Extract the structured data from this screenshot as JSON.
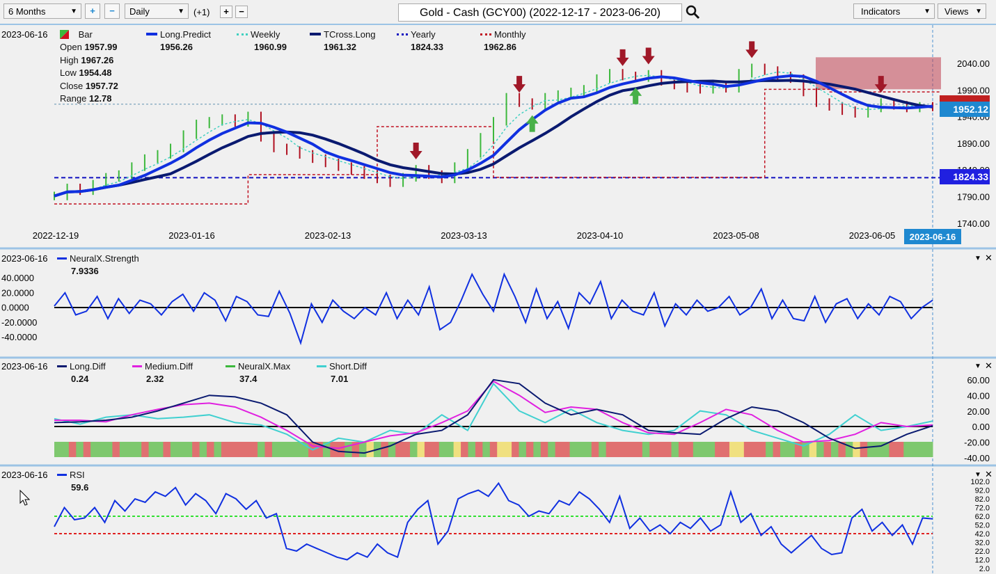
{
  "toolbar": {
    "period": "6 Months",
    "interval": "Daily",
    "offset": "(+1)",
    "title": "Gold - Cash (GCY00) (2022-12-17 - 2023-06-20)",
    "indicators": "Indicators",
    "views": "Views"
  },
  "price_panel": {
    "date": "2023-06-16",
    "bar_label": "Bar",
    "ohlc": [
      {
        "k": "Open",
        "v": "1957.99"
      },
      {
        "k": "High",
        "v": "1967.26"
      },
      {
        "k": "Low",
        "v": "1954.48"
      },
      {
        "k": "Close",
        "v": "1957.72"
      },
      {
        "k": "Range",
        "v": "12.78"
      }
    ],
    "legend": [
      {
        "name": "Long.Predict",
        "value": "1956.26",
        "color": "#1030e0"
      },
      {
        "name": "Weekly",
        "value": "1960.99",
        "color": "#40d0c0"
      },
      {
        "name": "TCross.Long",
        "value": "1961.32",
        "color": "#0a1a70"
      },
      {
        "name": "Yearly",
        "value": "1824.33",
        "color": "#1010c0"
      },
      {
        "name": "Monthly",
        "value": "1962.86",
        "color": "#c01020"
      }
    ],
    "y_ticks": [
      "2040.00",
      "1990.00",
      "1940.00",
      "1890.00",
      "1840.00",
      "1790.00",
      "1740.00"
    ],
    "x_ticks": [
      "2022-12-19",
      "2023-01-16",
      "2023-02-13",
      "2023-03-13",
      "2023-04-10",
      "2023-05-08",
      "2023-06-05"
    ],
    "current_date": "2023-06-16",
    "last_price": "1952.12",
    "yearly_label": "1824.33"
  },
  "chart_data": [
    {
      "type": "bar",
      "name": "price",
      "ylim": [
        1740,
        2060
      ],
      "yearly": 1824.33,
      "close": [
        1790,
        1805,
        1800,
        1812,
        1825,
        1830,
        1845,
        1860,
        1868,
        1880,
        1905,
        1925,
        1930,
        1935,
        1928,
        1940,
        1900,
        1880,
        1875,
        1868,
        1860,
        1852,
        1845,
        1838,
        1830,
        1822,
        1815,
        1825,
        1840,
        1830,
        1822,
        1845,
        1870,
        1900,
        1930,
        1975,
        1965,
        1960,
        1975,
        1980,
        1985,
        1990,
        2010,
        2020,
        2015,
        2012,
        2018,
        2005,
        1998,
        1992,
        1990,
        1995,
        1992,
        2020,
        2030,
        2025,
        2015,
        2010,
        1985,
        1965,
        1958,
        1950,
        1945,
        1955,
        1965,
        1960,
        1955,
        1958,
        1957
      ]
    },
    {
      "type": "line",
      "name": "NeuralX.Strength",
      "value": "7.9336",
      "ylim": [
        -50,
        50
      ],
      "y_ticks": [
        "40.0000",
        "20.0000",
        "0.0000",
        "-20.0000",
        "-40.0000"
      ],
      "values": [
        2,
        20,
        -10,
        -5,
        15,
        -15,
        12,
        -8,
        10,
        5,
        -10,
        8,
        18,
        -5,
        20,
        10,
        -18,
        15,
        8,
        -10,
        -12,
        22,
        -8,
        -48,
        5,
        -20,
        10,
        -5,
        -15,
        0,
        -10,
        20,
        -15,
        10,
        -10,
        28,
        -30,
        -20,
        10,
        45,
        18,
        -5,
        45,
        15,
        -20,
        25,
        -15,
        8,
        -28,
        20,
        5,
        35,
        -15,
        10,
        -5,
        -10,
        20,
        -25,
        5,
        -10,
        10,
        -5,
        0,
        15,
        -10,
        0,
        25,
        -15,
        10,
        -15,
        -18,
        15,
        -20,
        5,
        12,
        -15,
        5,
        -10,
        15,
        8,
        -15,
        0,
        10
      ]
    },
    {
      "type": "line",
      "name": "oscillators",
      "ylim": [
        -45,
        65
      ],
      "y_ticks": [
        "60.00",
        "40.00",
        "20.00",
        "0.00",
        "-20.00",
        "-40.00"
      ],
      "series": [
        {
          "name": "Long.Diff",
          "value": "0.24",
          "color": "#0a1a70",
          "values": [
            5,
            6,
            8,
            12,
            20,
            30,
            40,
            38,
            30,
            15,
            -20,
            -32,
            -34,
            -25,
            -10,
            -5,
            15,
            60,
            55,
            30,
            15,
            22,
            15,
            -5,
            -8,
            -10,
            10,
            25,
            20,
            5,
            -15,
            -28,
            -25,
            -10,
            1
          ]
        },
        {
          "name": "Medium.Diff",
          "value": "2.32",
          "color": "#e020e0",
          "values": [
            8,
            8,
            6,
            15,
            22,
            28,
            30,
            25,
            12,
            -5,
            -25,
            -28,
            -20,
            -12,
            -8,
            5,
            20,
            58,
            40,
            18,
            25,
            22,
            5,
            -8,
            -10,
            5,
            22,
            15,
            -5,
            -20,
            -18,
            -10,
            5,
            0,
            2
          ]
        },
        {
          "name": "Short.Diff",
          "value": "7.01",
          "color": "#40d0d0",
          "values": [
            10,
            3,
            12,
            15,
            10,
            12,
            15,
            5,
            2,
            -10,
            -30,
            -15,
            -20,
            -5,
            -10,
            15,
            -5,
            55,
            20,
            5,
            22,
            5,
            -5,
            -10,
            -5,
            20,
            15,
            -5,
            -15,
            -25,
            -10,
            15,
            -5,
            0,
            7
          ]
        }
      ],
      "max_name": "NeuralX.Max",
      "max_value": "37.4",
      "max_colors": "ggrgrgggrgggrggrgggrgrgrrrrrgrgggggrrgrrgrgygrgrrgyrrggyrgrgryyrgrgrgrrgggrgrrrrrgrrrgrrgggrryyrrrgrggrgygrgrgyrgggrrgggg"
    },
    {
      "type": "line",
      "name": "RSI",
      "value": "59.6",
      "ylim": [
        2,
        102
      ],
      "y_ticks": [
        "102.0",
        "92.0",
        "82.0",
        "72.0",
        "62.0",
        "52.0",
        "42.0",
        "32.0",
        "22.0",
        "12.0",
        "2.0"
      ],
      "upper": 62,
      "lower": 42,
      "values": [
        50,
        72,
        58,
        60,
        72,
        55,
        80,
        68,
        82,
        78,
        90,
        85,
        95,
        75,
        88,
        80,
        65,
        88,
        82,
        70,
        80,
        60,
        65,
        25,
        22,
        30,
        25,
        20,
        15,
        12,
        20,
        15,
        30,
        20,
        15,
        55,
        70,
        80,
        30,
        45,
        82,
        88,
        92,
        85,
        100,
        80,
        75,
        62,
        68,
        65,
        80,
        75,
        90,
        82,
        70,
        55,
        85,
        48,
        60,
        45,
        52,
        42,
        55,
        48,
        60,
        45,
        52,
        90,
        55,
        65,
        40,
        50,
        30,
        20,
        30,
        40,
        25,
        18,
        20,
        60,
        70,
        45,
        55,
        40,
        52,
        30,
        60,
        59
      ]
    }
  ],
  "colors": {
    "up": "#3cb83c",
    "down": "#b01020",
    "accent": "#1e88d0"
  },
  "icons": {
    "search": "magnifier-icon"
  }
}
